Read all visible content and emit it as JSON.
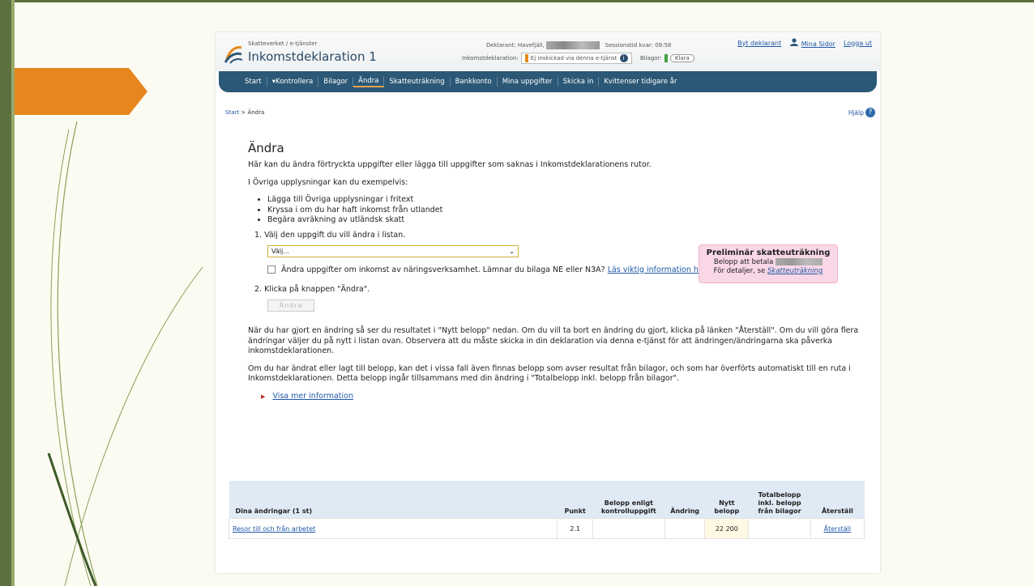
{
  "header": {
    "brand_small": "Skatteverket / e-tjänster",
    "title": "Inkomstdeklaration 1",
    "deklarant_label": "Deklarant: Havefjäll,",
    "session_label": "Sessionstid kvar: 09:58",
    "inkomst_label": "Inkomstdeklaration:",
    "status_text": "Ej inskickad via denna e-tjänst",
    "bilagor_label": "Bilagor:",
    "bilagor_status": "Klara",
    "byt_deklarant": "Byt deklarant",
    "mina_sidor": "Mina Sidor",
    "logga_ut": "Logga ut"
  },
  "nav": [
    "Start",
    "Kontrollera",
    "Bilagor",
    "Ändra",
    "Skatteuträkning",
    "Bankkonto",
    "Mina uppgifter",
    "Skicka in",
    "Kvittenser tidigare år"
  ],
  "breadcrumb": {
    "start": "Start",
    "sep": ">",
    "current": "Ändra"
  },
  "help": "Hjälp",
  "main": {
    "title": "Ändra",
    "intro": "Här kan du ändra förtryckta uppgifter eller lägga till uppgifter som saknas i Inkomstdeklarationens rutor.",
    "ovriga": "I Övriga upplysningar kan du exempelvis:",
    "bullets": [
      "Lägga till Övriga upplysningar i fritext",
      "Kryssa i om du har haft inkomst från utlandet",
      "Begära avräkning av utländsk skatt"
    ],
    "step1": "1. Välj den uppgift du vill ändra i listan.",
    "select_value": "Välj...",
    "checkbox_text": "Ändra uppgifter om inkomst av näringsverksamhet. Lämnar du bilaga NE eller N3A?",
    "checkbox_link": "Läs viktig information här.",
    "step2": "2. Klicka på knappen \"Ändra\".",
    "button": "Ändra",
    "para1": "När du har gjort en ändring så ser du resultatet i \"Nytt belopp\" nedan. Om du vill ta bort en ändring du gjort, klicka på länken \"Återställ\". Om du vill göra flera ändringar väljer du på nytt i listan ovan. Observera att du måste skicka in din deklaration via denna e-tjänst för att ändringen/ändringarna ska påverka inkomstdeklarationen.",
    "para2": "Om du har ändrat eller lagt till belopp, kan det i vissa fall även finnas belopp som avser resultat från bilagor, och som har överförts automatiskt till en ruta i Inkomstdeklarationen. Detta belopp ingår tillsammans med din ändring i \"Totalbelopp inkl. belopp från bilagor\".",
    "more": "Visa mer information"
  },
  "prelim": {
    "title": "Preliminär skatteuträkning",
    "belopp": "Belopp att betala",
    "detaljer": "För detaljer, se",
    "link": "Skatteuträkning"
  },
  "table": {
    "headers": [
      "Dina ändringar (1 st)",
      "Punkt",
      "Belopp enligt kontrolluppgift",
      "Ändring",
      "Nytt belopp",
      "Totalbelopp inkl. belopp från bilagor",
      "Återställ"
    ],
    "rows": [
      {
        "name": "Resor till och från arbetet",
        "punkt": "2.1",
        "belopp": "",
        "andring": "",
        "nytt": "22 200",
        "total": "",
        "reset": "Återställ"
      }
    ]
  }
}
